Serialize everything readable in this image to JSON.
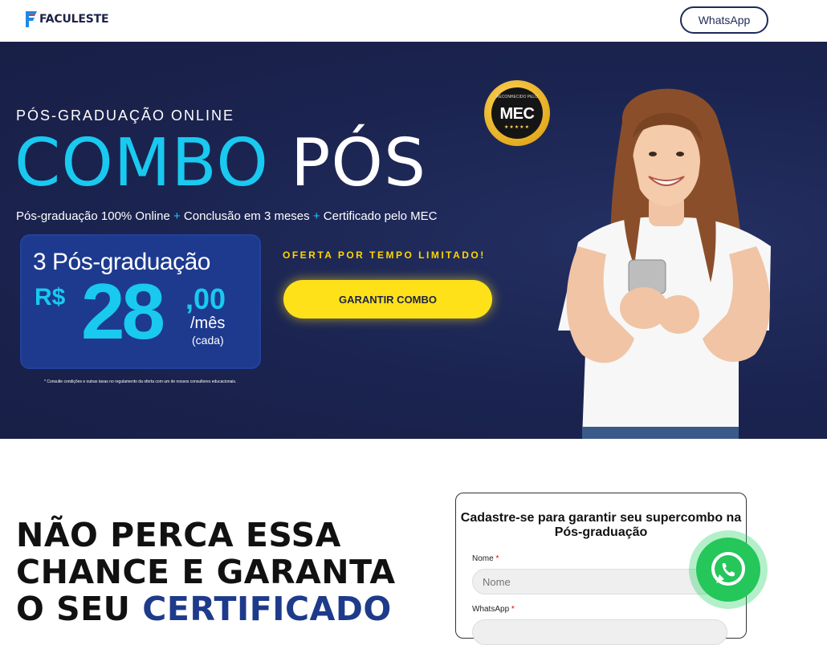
{
  "header": {
    "logo_text": "FACULESTE",
    "whatsapp_button": "WhatsApp"
  },
  "hero": {
    "eyebrow": "PÓS-GRADUAÇÃO ONLINE",
    "headline_part1": "COMBO",
    "headline_part2": "PÓS",
    "subtitle": {
      "item1": "Pós-graduação 100% Online",
      "plus": "+",
      "item2": "Conclusão em 3 meses",
      "item3": "Certificado pelo MEC"
    },
    "price_card": {
      "title": "3 Pós-graduação",
      "currency": "R$",
      "integer": "28",
      "decimal": ",00",
      "period": "/mês",
      "each": "(cada)"
    },
    "disclaimer": "* Consulte condições e outras taxas no regulamento da oferta com um de nossos consultores educacionais.",
    "offer_label": "OFERTA POR TEMPO LIMITADO!",
    "cta_button": "GARANTIR COMBO",
    "mec_badge": {
      "small_text": "RECONHECIDO PELO",
      "big_text": "MEC",
      "stars": "★★★★★"
    }
  },
  "section": {
    "heading_line1": "NÃO PERCA ESSA",
    "heading_line2": "CHANCE E GARANTA",
    "heading_line3_a": "O SEU ",
    "heading_line3_b": "CERTIFICADO"
  },
  "form": {
    "title": "Cadastre-se para garantir seu supercombo na Pós-graduação",
    "name_label": "Nome",
    "name_placeholder": "Nome",
    "whatsapp_label": "WhatsApp",
    "required_mark": "*"
  },
  "icons": {
    "whatsapp_float": "whatsapp-icon",
    "logo_mark": "faculeste-logo-icon"
  },
  "colors": {
    "hero_bg": "#1b2450",
    "accent_cyan": "#19c9f0",
    "accent_yellow": "#ffe11a",
    "price_card": "#1d3a8f",
    "whatsapp_green": "#25c65a"
  }
}
